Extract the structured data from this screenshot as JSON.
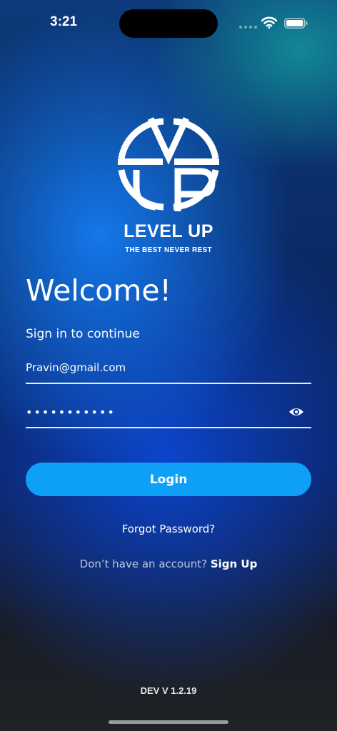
{
  "status_bar": {
    "time": "3:21"
  },
  "brand": {
    "name": "LEVEL UP",
    "tagline": "THE BEST NEVER REST",
    "logo_icon": "level-up-logo"
  },
  "welcome": {
    "title": "Welcome!",
    "subtitle": "Sign in to continue"
  },
  "form": {
    "email_value": "Pravin@gmail.com",
    "password_value": "•••••••••••",
    "eye_icon": "eye-icon"
  },
  "actions": {
    "login_label": "Login",
    "forgot_label": "Forgot Password?",
    "signup_prompt": "Don’t have an account?",
    "signup_label": "Sign Up"
  },
  "footer": {
    "version": "DEV V 1.2.19"
  },
  "colors": {
    "accent": "#0ea0f7",
    "text": "#ffffff"
  }
}
